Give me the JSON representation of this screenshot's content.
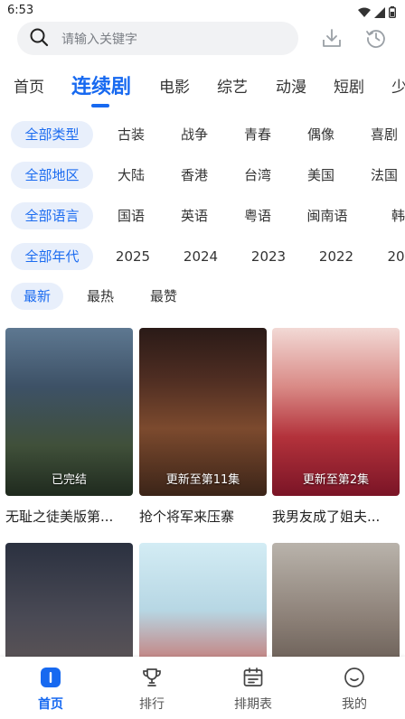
{
  "status_bar": {
    "time": "6:53"
  },
  "search": {
    "placeholder": "请输入关键字"
  },
  "header_icons": [
    "download-icon",
    "history-icon"
  ],
  "nav_tabs": [
    "首页",
    "连续剧",
    "电影",
    "综艺",
    "动漫",
    "短剧",
    "少"
  ],
  "nav_active_index": 1,
  "filters": {
    "type": [
      "全部类型",
      "古装",
      "战争",
      "青春",
      "偶像",
      "喜剧"
    ],
    "region": [
      "全部地区",
      "大陆",
      "香港",
      "台湾",
      "美国",
      "法国"
    ],
    "language": [
      "全部语言",
      "国语",
      "英语",
      "粤语",
      "闽南语",
      "韩语"
    ],
    "year": [
      "全部年代",
      "2025",
      "2024",
      "2023",
      "2022",
      "20"
    ],
    "sort": [
      "最新",
      "最热",
      "最赞"
    ]
  },
  "cards": [
    {
      "title": "无耻之徒美版第...",
      "status": "已完结"
    },
    {
      "title": "抢个将军来压寨",
      "status": "更新至第11集"
    },
    {
      "title": "我男友成了姐夫...",
      "status": "更新至第2集"
    },
    {
      "title": "",
      "status": ""
    },
    {
      "title": "",
      "status": ""
    },
    {
      "title": "",
      "status": ""
    }
  ],
  "tab_bar": [
    "首页",
    "排行",
    "排期表",
    "我的"
  ],
  "tab_bar_active_index": 0,
  "colors": {
    "accent": "#1769f0",
    "chip_selected_bg": "#e8effb",
    "search_bg": "#f1f2f4"
  }
}
